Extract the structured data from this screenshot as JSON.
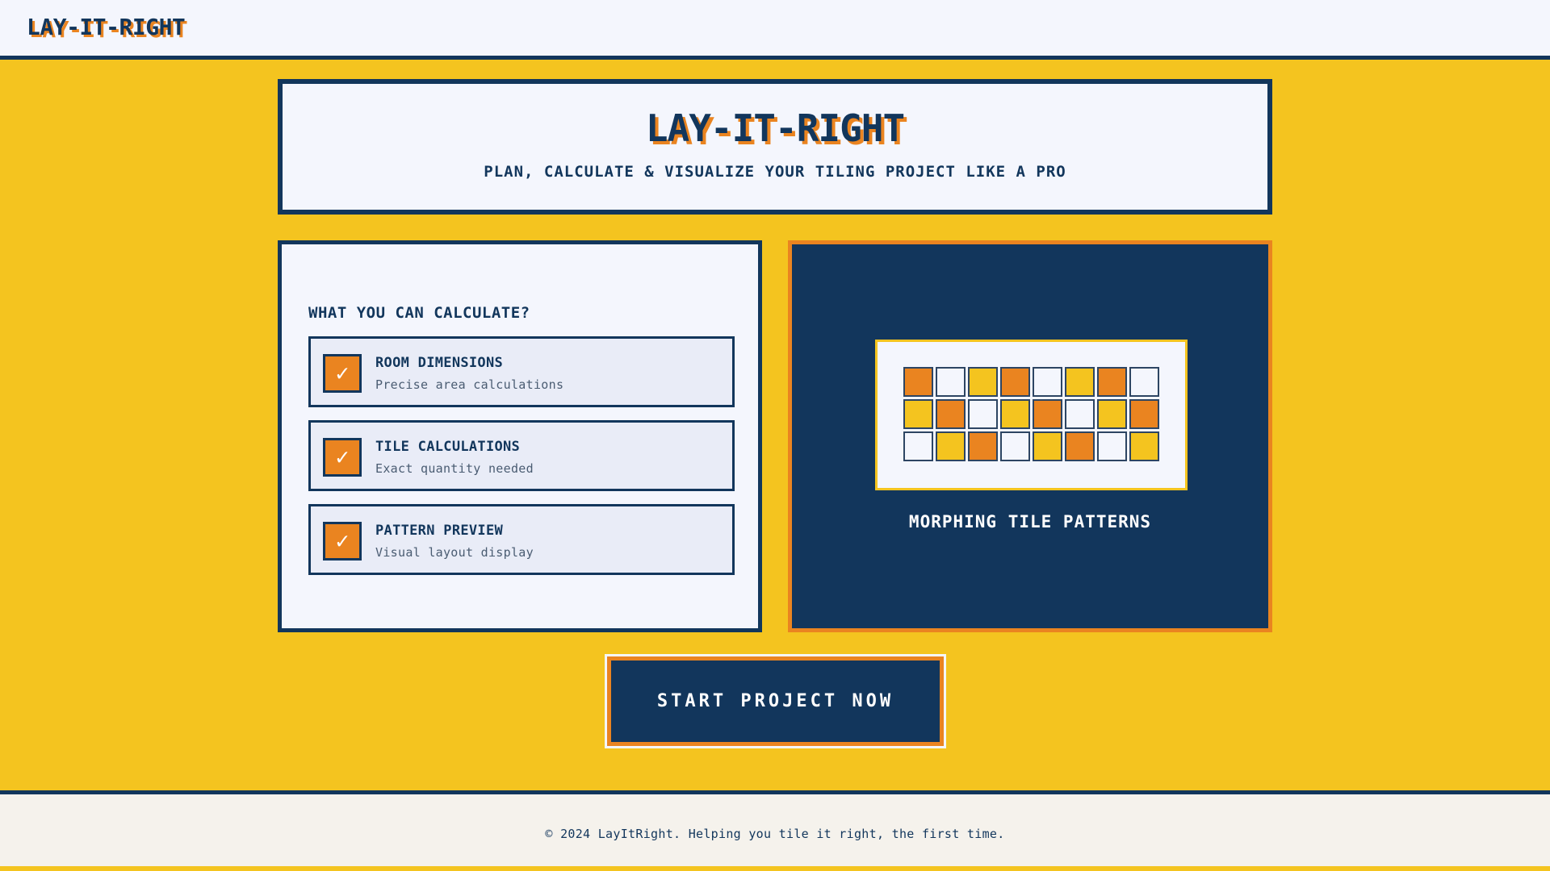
{
  "header": {
    "logo": "LAY-IT-RIGHT"
  },
  "hero": {
    "title": "LAY-IT-RIGHT",
    "subtitle": "PLAN, CALCULATE & VISUALIZE YOUR TILING PROJECT LIKE A PRO"
  },
  "features": {
    "heading": "WHAT YOU CAN CALCULATE?",
    "check_glyph": "✓",
    "items": [
      {
        "title": "ROOM DIMENSIONS",
        "description": "Precise area calculations"
      },
      {
        "title": "TILE CALCULATIONS",
        "description": "Exact quantity needed"
      },
      {
        "title": "PATTERN PREVIEW",
        "description": "Visual layout display"
      }
    ]
  },
  "pattern_preview": {
    "label": "MORPHING TILE PATTERNS",
    "tiles": [
      [
        "orange",
        "white",
        "yellow",
        "orange",
        "white",
        "yellow",
        "orange",
        "white"
      ],
      [
        "yellow",
        "orange",
        "white",
        "yellow",
        "orange",
        "white",
        "yellow",
        "orange"
      ],
      [
        "white",
        "yellow",
        "orange",
        "white",
        "yellow",
        "orange",
        "white",
        "yellow"
      ]
    ]
  },
  "cta": {
    "label": "START PROJECT NOW"
  },
  "footer": {
    "text": "© 2024 LayItRight. Helping you tile it right, the first time."
  },
  "colors": {
    "navy": "#12365c",
    "orange": "#ea8420",
    "yellow": "#f4c41f",
    "offwhite": "#f4f6fd"
  }
}
